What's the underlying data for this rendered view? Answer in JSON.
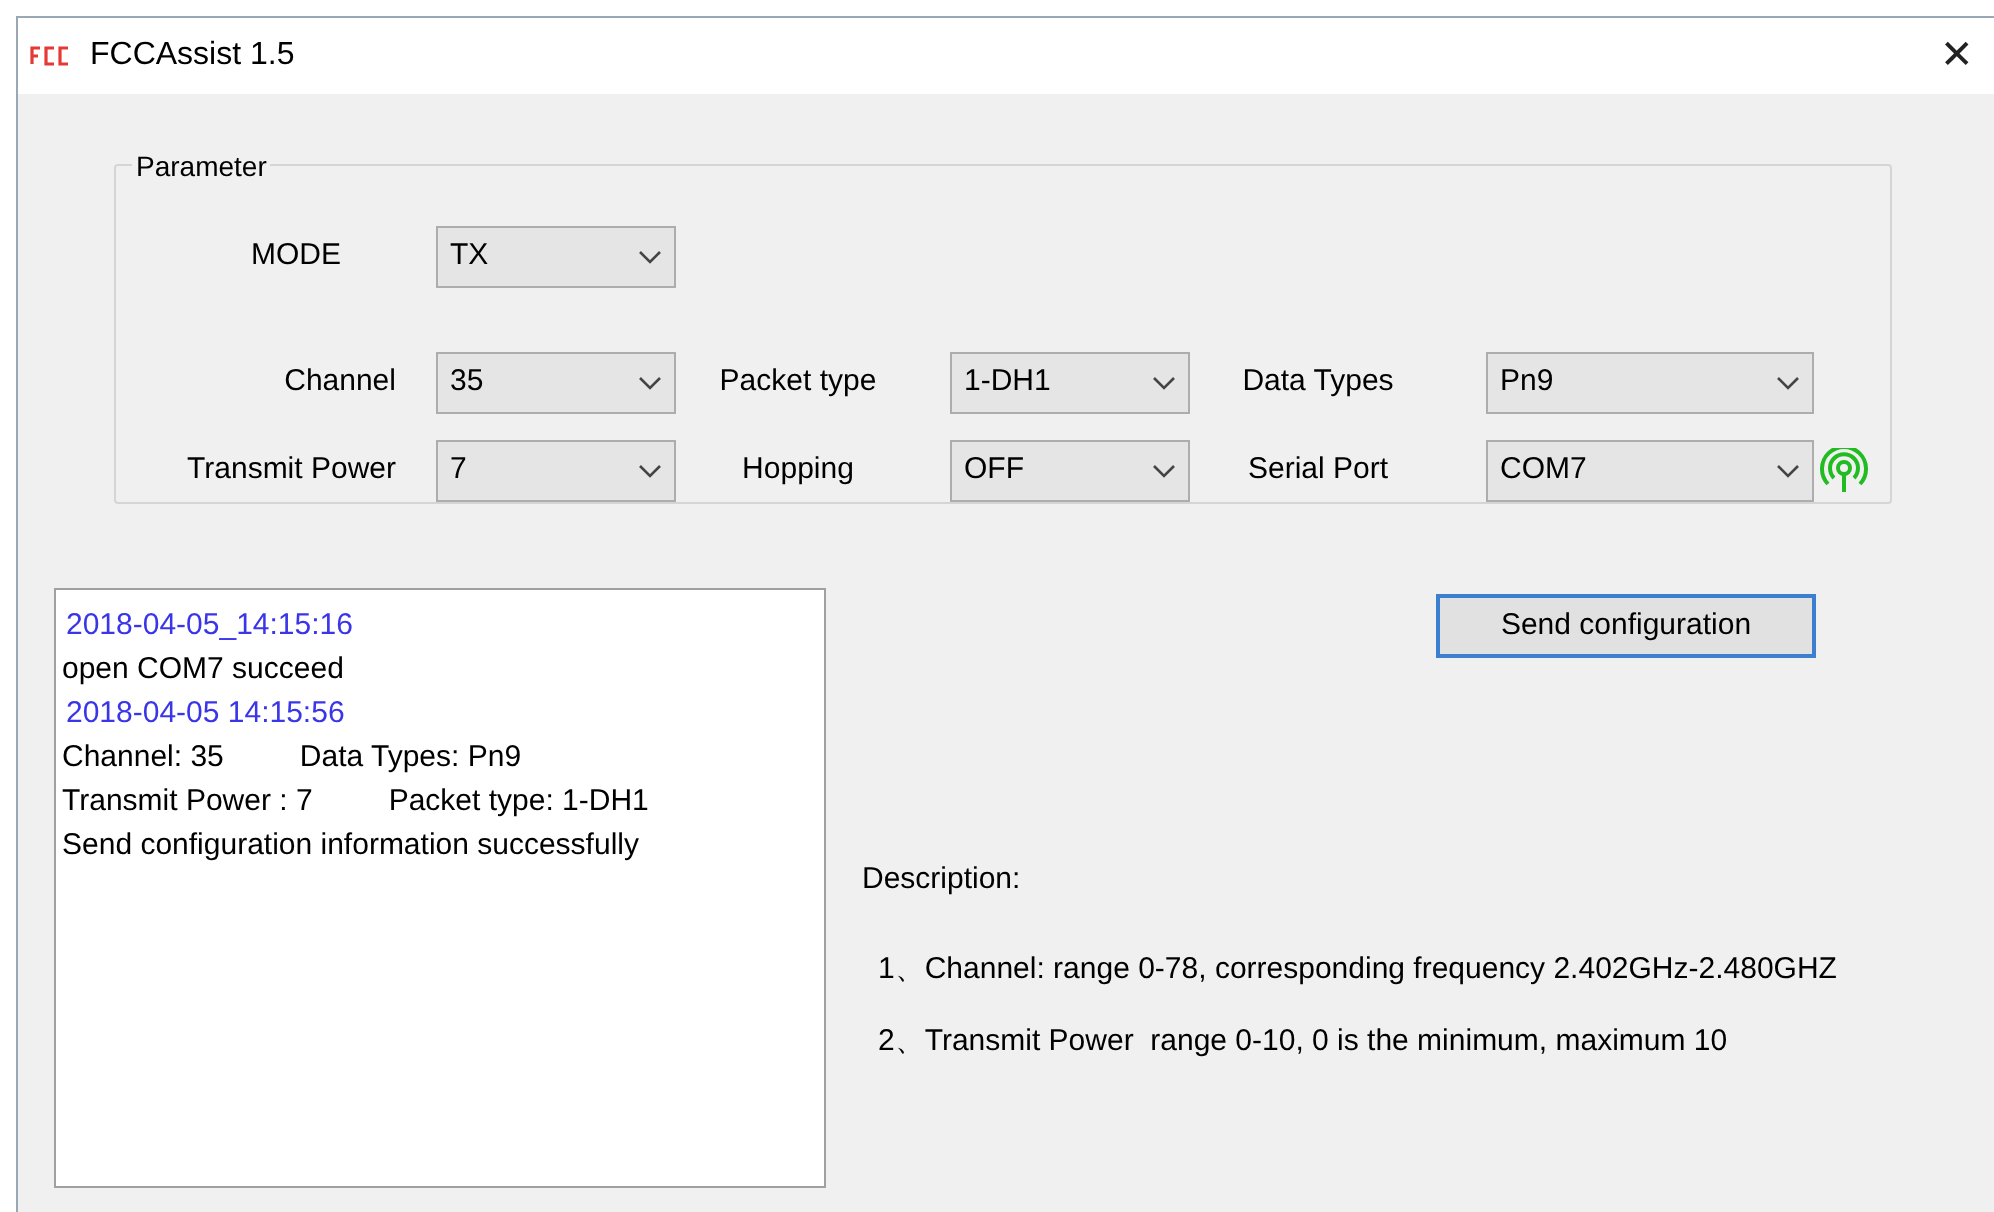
{
  "window": {
    "title": "FCCAssist 1.5",
    "close": "✕"
  },
  "parameter": {
    "title": "Parameter",
    "mode": {
      "label": "MODE",
      "value": "TX"
    },
    "rows": [
      [
        {
          "label": "Channel",
          "value": "35"
        },
        {
          "label": "Packet type",
          "value": "1-DH1"
        },
        {
          "label": "Data Types",
          "value": "Pn9"
        }
      ],
      [
        {
          "label": "Transmit Power",
          "value": "7"
        },
        {
          "label": "Hopping",
          "value": "OFF"
        },
        {
          "label": "Serial Port",
          "value": "COM7",
          "connected": true
        }
      ]
    ]
  },
  "log": [
    {
      "kind": "timestamp",
      "text": "2018-04-05_14:15:16"
    },
    {
      "kind": "text",
      "text": "open COM7 succeed"
    },
    {
      "kind": "timestamp",
      "text": "2018-04-05 14:15:56"
    },
    {
      "kind": "pair",
      "parts": [
        "Channel: 35",
        "Data Types: Pn9"
      ]
    },
    {
      "kind": "pair",
      "parts": [
        "Transmit Power : 7",
        "Packet type: 1-DH1"
      ]
    },
    {
      "kind": "text",
      "text": "Send configuration information successfully"
    }
  ],
  "send_button": "Send configuration",
  "description": {
    "title": "Description:",
    "items": [
      "1、Channel: range 0-78, corresponding frequency 2.402GHz-2.480GHZ",
      "2、Transmit Power  range 0-10, 0 is the minimum, maximum 10"
    ]
  }
}
